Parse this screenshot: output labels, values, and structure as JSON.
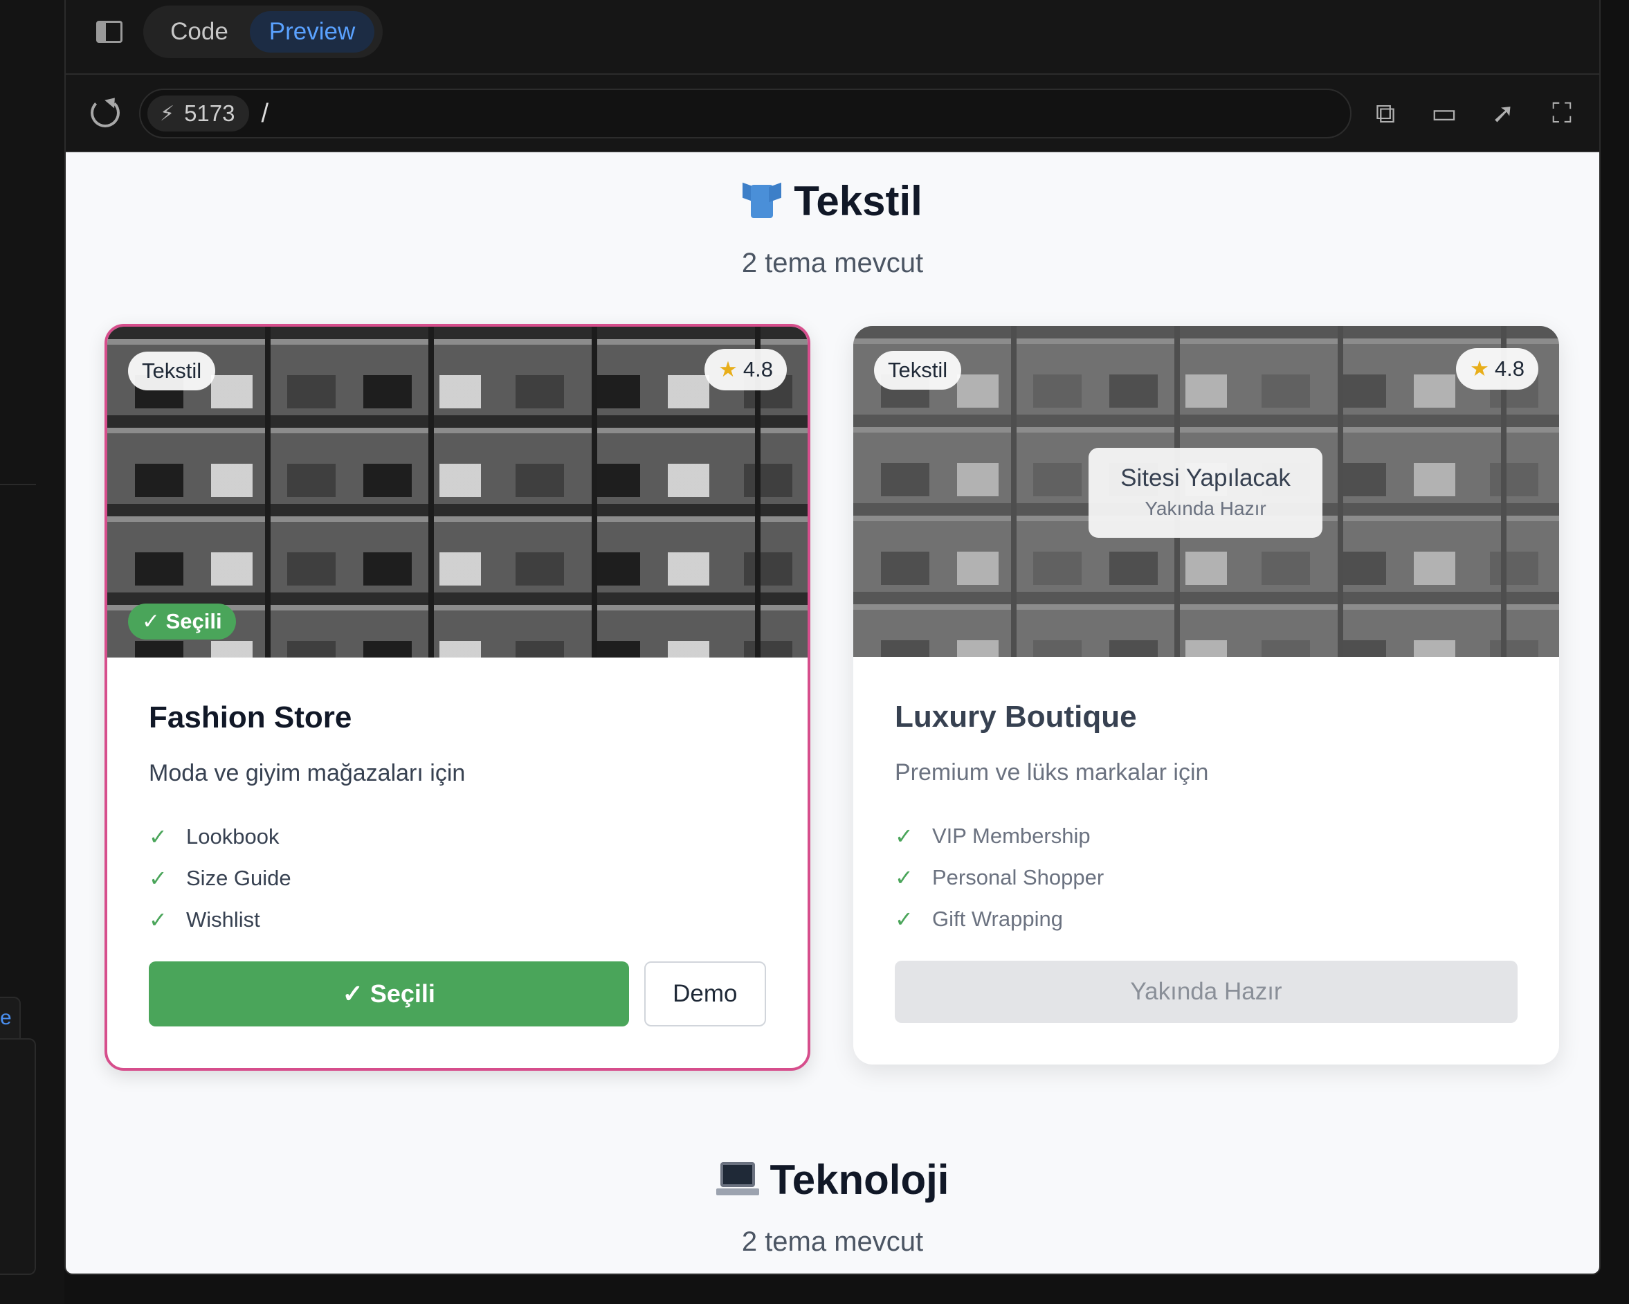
{
  "editor": {
    "tabs": [
      {
        "label": "Code",
        "active": false
      },
      {
        "label": "Preview",
        "active": true
      }
    ],
    "port": "5173",
    "path": "/",
    "left_fragment": "e"
  },
  "sections": [
    {
      "emoji": "shirt-icon",
      "title": "Tekstil",
      "subtitle": "2 tema mevcut",
      "cards": [
        {
          "category": "Tekstil",
          "rating": "4.8",
          "selected_badge": "✓ Seçili",
          "title": "Fashion Store",
          "description": "Moda ve giyim mağazaları için",
          "features": [
            "Lookbook",
            "Size Guide",
            "Wishlist"
          ],
          "primary_button": "✓ Seçili",
          "demo_button": "Demo",
          "state": "selected"
        },
        {
          "category": "Tekstil",
          "rating": "4.8",
          "overlay_title": "Sitesi Yapılacak",
          "overlay_subtitle": "Yakında Hazır",
          "title": "Luxury Boutique",
          "description": "Premium ve lüks markalar için",
          "features": [
            "VIP Membership",
            "Personal Shopper",
            "Gift Wrapping"
          ],
          "disabled_button": "Yakında Hazır",
          "state": "coming-soon"
        }
      ]
    },
    {
      "emoji": "laptop-icon",
      "title": "Teknoloji",
      "subtitle": "2 tema mevcut"
    }
  ],
  "colors": {
    "accent_blue": "#5aa2ff",
    "selected_border": "#d64e8c",
    "success_green": "#4aa55a",
    "star": "#e8ae1a"
  }
}
